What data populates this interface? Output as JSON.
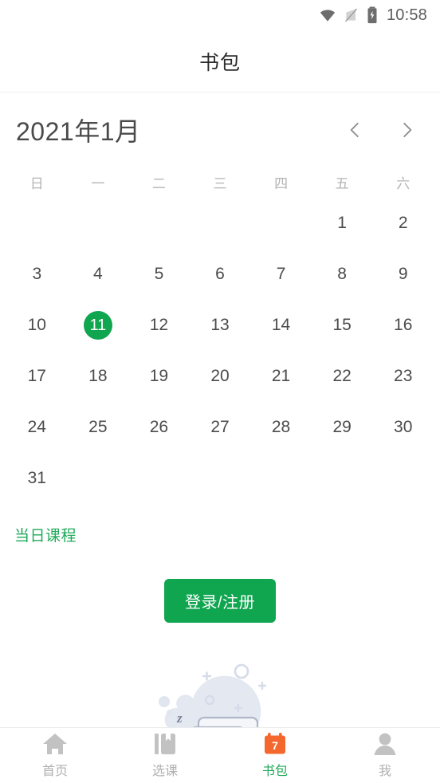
{
  "theme": {
    "green": "#10a54f",
    "green_text": "#1faa59",
    "orange": "#f4682e",
    "gray_text": "#4b4b4b",
    "muted": "#b4b4b4",
    "illus_blue": "#dfe4ef"
  },
  "statusbar": {
    "wifi_icon": "wifi-icon",
    "signal_icon": "signal-icon",
    "battery_icon": "battery-charging-icon",
    "time": "10:58"
  },
  "header": {
    "title": "书包"
  },
  "calendar": {
    "month_label": "2021年1月",
    "prev_icon": "chevron-left-icon",
    "next_icon": "chevron-right-icon",
    "weekdays": [
      "日",
      "一",
      "二",
      "三",
      "四",
      "五",
      "六"
    ],
    "selected_day": 11,
    "weeks": [
      [
        "",
        "",
        "",
        "",
        "",
        "1",
        "2"
      ],
      [
        "3",
        "4",
        "5",
        "6",
        "7",
        "8",
        "9"
      ],
      [
        "10",
        "11",
        "12",
        "13",
        "14",
        "15",
        "16"
      ],
      [
        "17",
        "18",
        "19",
        "20",
        "21",
        "22",
        "23"
      ],
      [
        "24",
        "25",
        "26",
        "27",
        "28",
        "29",
        "30"
      ],
      [
        "31",
        "",
        "",
        "",
        "",
        "",
        ""
      ]
    ]
  },
  "section": {
    "today_courses_label": "当日课程"
  },
  "auth": {
    "login_label": "登录/注册"
  },
  "empty_state": {
    "illustration_name": "sleeping-cards-illustration"
  },
  "tabbar": {
    "items": [
      {
        "label": "首页",
        "icon": "home-icon",
        "active": false,
        "badge": ""
      },
      {
        "label": "选课",
        "icon": "book-bookmark-icon",
        "active": false,
        "badge": ""
      },
      {
        "label": "书包",
        "icon": "calendar-icon",
        "active": true,
        "badge": "7"
      },
      {
        "label": "我",
        "icon": "person-icon",
        "active": false,
        "badge": ""
      }
    ]
  }
}
